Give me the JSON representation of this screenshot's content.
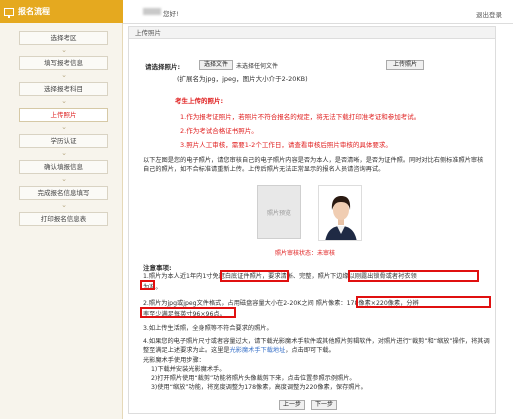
{
  "sidebar": {
    "title": "报名流程",
    "steps": [
      "选择考区",
      "填写报考信息",
      "选择报考科目",
      "上传照片",
      "学历认证",
      "确认填报信息",
      "完成报名信息填写",
      "打印报名信息表"
    ]
  },
  "header": {
    "greeting": "您好!",
    "logout": "退出登录"
  },
  "panel": {
    "title": "上传照片",
    "select_label": "请选择照片:",
    "choose_file": "选择文件",
    "no_file": "未选择任何文件",
    "upload_button": "上传照片",
    "format_hint": "(扩展名为jpg，jpeg，图片大小介于2-20KB)",
    "notice_title": "考生上传的照片:",
    "notices": [
      "1.作为报考证照片，若照片不符合报名的规定，将无法下载打印准考证和参加考试。",
      "2.作为考试合格证书照片。",
      "3.照片人工审核，需要1-2个工作日，请查看审核后照片审核的具体要求。"
    ],
    "intro": "以下左图是您的电子照片，请您审核自己的电子照片内容是否为本人，是否清晰，是否为证件照。同时对比右侧标准照片审核自己的照片，如不合标准请重新上传。上传后照片无法正常显示的报名人员请咨询再试。",
    "placeholder_text": "照片预览",
    "audit_status": "照片审核状态：未审核",
    "notes_title": "注意事项:",
    "note1_a": "1.照片为本人近1年内",
    "note1_b": "1寸免冠白底证件照片",
    "note1_c": "，要求清晰、完整，",
    "note1_d": "照片下边缘以刚露出锁骨或者衬衣领",
    "note1_e": "为准",
    "note1_f": "。",
    "note2_a": "2.照片为jpg或jpeg文件格式，占用磁盘容量大小在2-20K之间",
    "note2_b": "照片像素：178像素×220像素，分辨",
    "note2_c": "率至少满足每英寸96×96点",
    "note2_d": "。",
    "note3": "3.如上传生活照，全身照等不符合要求的照片。",
    "note4": "4.如果您的电子照片尺寸或者容量过大，请下载光影魔术手软件或其他照片剪辑软件，对照片进行“裁剪”和“缩放”操作，将其调整至满足上述要求为止。这里是光影魔术手下载地址，点击即可下载。",
    "note4_link": "光影魔术手下载地址",
    "steps_title": "光影魔术手使用步骤：",
    "steps": [
      "1)下载并安装光影魔术手。",
      "2)打开照片使用“裁剪”功能将照片头像裁剪下来，点击位置参照示例照片。",
      "3)使用“缩放”功能，将宽度调整为178像素，高度调整为220像素，保存照片。"
    ],
    "prev_button": "上一步",
    "next_button": "下一步"
  },
  "colors": {
    "sidebar_header": "#e5a91f",
    "highlight_red": "#e01010",
    "active_step": "#d22222"
  }
}
